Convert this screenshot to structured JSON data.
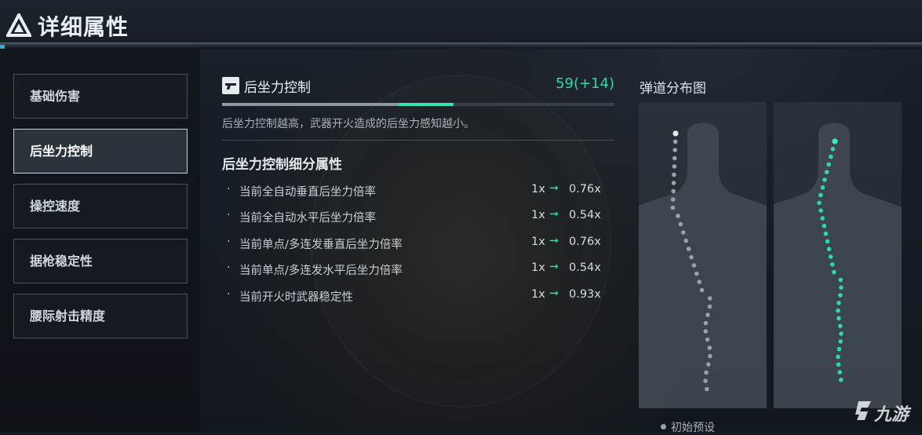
{
  "header": {
    "title": "详细属性"
  },
  "sidebar": {
    "items": [
      {
        "label": "基础伤害",
        "active": false
      },
      {
        "label": "后坐力控制",
        "active": true
      },
      {
        "label": "操控速度",
        "active": false
      },
      {
        "label": "据枪稳定性",
        "active": false
      },
      {
        "label": "腰际射击精度",
        "active": false
      }
    ]
  },
  "detail": {
    "icon": "pistol-icon",
    "title": "后坐力控制",
    "value": "59(+14)",
    "bar": {
      "base_fraction": 0.45,
      "bonus_fraction": 0.14
    },
    "description": "后坐力控制越高，武器开火造成的后坐力感知越小。",
    "subsection_title": "后坐力控制细分属性",
    "attributes": [
      {
        "bullet": "·",
        "label": "当前全自动垂直后坐力倍率",
        "base": "1x",
        "value": "0.76x"
      },
      {
        "bullet": "·",
        "label": "当前全自动水平后坐力倍率",
        "base": "1x",
        "value": "0.54x"
      },
      {
        "bullet": "·",
        "label": "当前单点/多连发垂直后坐力倍率",
        "base": "1x",
        "value": "0.76x"
      },
      {
        "bullet": "·",
        "label": "当前单点/多连发水平后坐力倍率",
        "base": "1x",
        "value": "0.54x"
      },
      {
        "bullet": "·",
        "label": "当前开火时武器稳定性",
        "base": "1x",
        "value": "0.93x"
      }
    ],
    "arrow": "➞"
  },
  "ballistics": {
    "title": "弹道分布图",
    "legend_initial": "初始预设"
  },
  "colors": {
    "accent": "#2ed8a8",
    "initial_dots": "#9aa2a9",
    "current_dots": "#2ed8a8"
  },
  "watermark": "九游"
}
